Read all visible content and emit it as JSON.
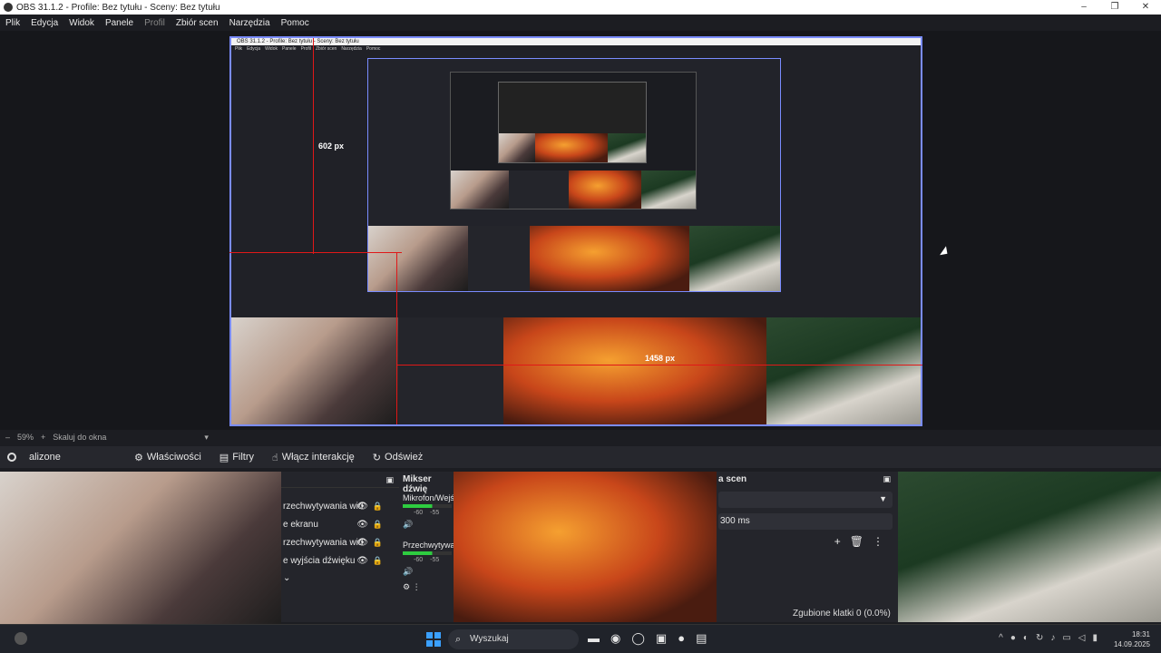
{
  "window": {
    "title": "OBS 31.1.2 - Profile: Bez tytułu - Sceny: Bez tytułu",
    "controls": [
      "–",
      "❐",
      "✕"
    ]
  },
  "menu": [
    "Plik",
    "Edycja",
    "Widok",
    "Panele",
    "Profil",
    "Zbiór scen",
    "Narzędzia",
    "Pomoc"
  ],
  "preview": {
    "dim_vertical": "602 px",
    "dim_horizontal": "1458 px"
  },
  "zoom": {
    "minus": "–",
    "value": "59%",
    "plus": "+",
    "mode": "Skaluj do okna",
    "dropdown": "▾"
  },
  "source_toolbar": {
    "source_name": "alizone",
    "properties": "Właściwości",
    "filters": "Filtry",
    "interact": "Włącz interakcję",
    "refresh": "Odśwież"
  },
  "sources_dock": {
    "items": [
      "rzechwytywania wid",
      "e ekranu",
      "rzechwytywania wid",
      "e wyjścia dźwięku"
    ]
  },
  "mixer_dock": {
    "title": "Mikser dźwię",
    "tracks": [
      {
        "name": "Mikrofon/Wejść",
        "scale_a": "-60",
        "scale_b": "-55"
      },
      {
        "name": "Przechwytywa",
        "scale_a": "-60",
        "scale_b": "-55"
      }
    ]
  },
  "transitions_dock": {
    "title": "a scen",
    "duration": "300 ms"
  },
  "status": {
    "dropped_frames": "Zgubione klatki 0 (0.0%)"
  },
  "taskbar": {
    "search_placeholder": "Wyszukaj",
    "time": "18:31",
    "date": "14.09.2025"
  }
}
